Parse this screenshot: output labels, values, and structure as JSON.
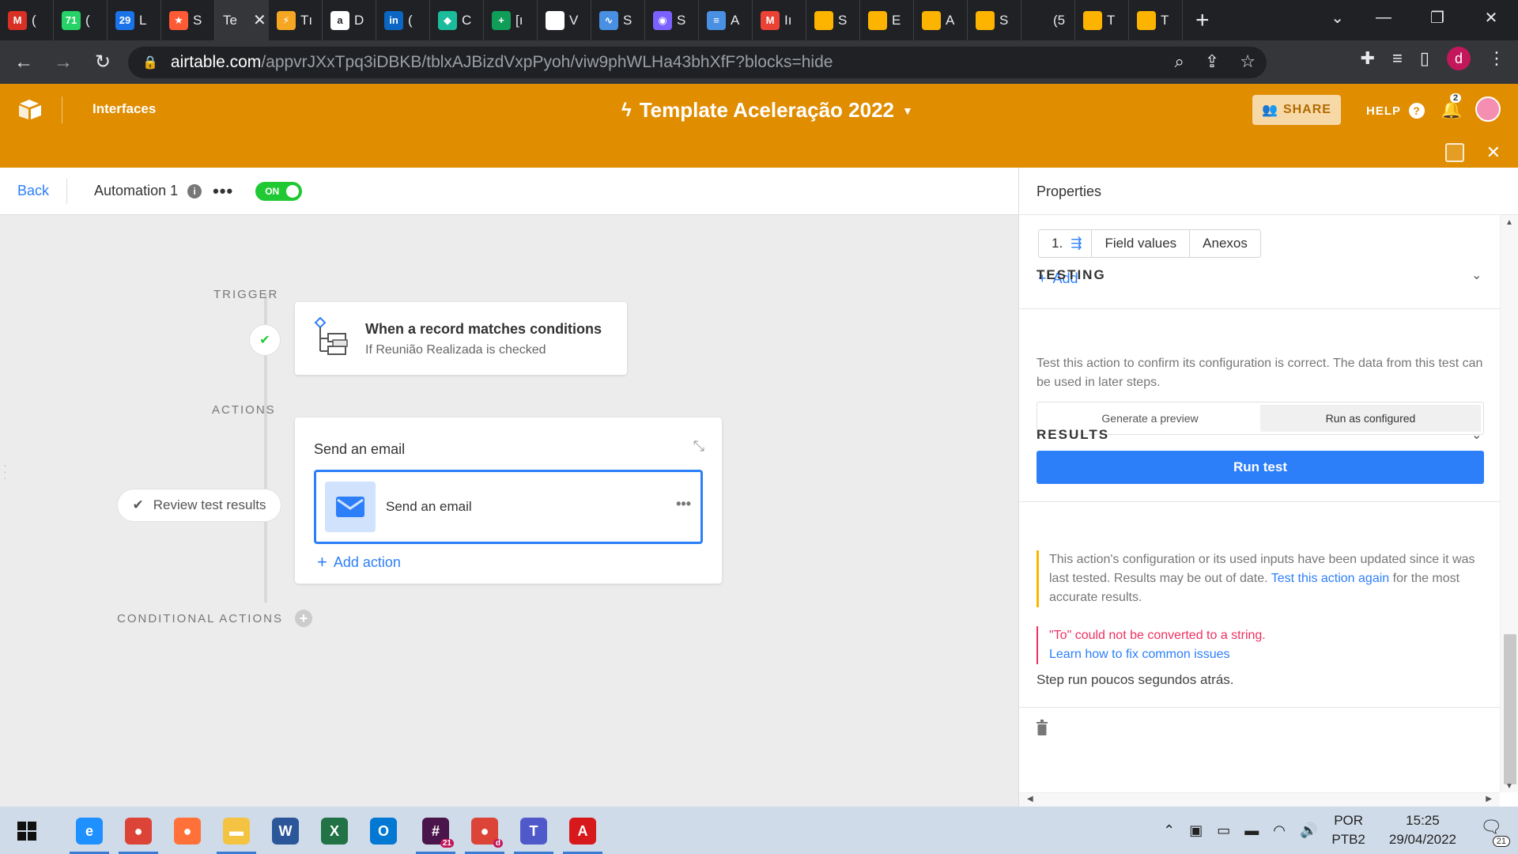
{
  "browser": {
    "tabs": [
      {
        "title": "(",
        "icon": "gmail-like-icon",
        "color": "#d93025",
        "glyph": "M"
      },
      {
        "title": "(",
        "icon": "whatsapp-icon",
        "color": "#25d366",
        "glyph": "71"
      },
      {
        "title": "L",
        "icon": "calendar-icon",
        "color": "#1a73e8",
        "glyph": "29"
      },
      {
        "title": "S",
        "icon": "star-icon",
        "color": "#ff5a36",
        "glyph": "★"
      },
      {
        "title": "Te",
        "icon": "airtable-icon",
        "color": "#35363a",
        "glyph": ""
      },
      {
        "title": "Tı",
        "icon": "bolt-icon",
        "color": "#f5a623",
        "glyph": "⚡"
      },
      {
        "title": "D",
        "icon": "a-icon",
        "color": "#ffffff",
        "glyph": "a"
      },
      {
        "title": "(",
        "icon": "linkedin-icon",
        "color": "#0a66c2",
        "glyph": "in"
      },
      {
        "title": "C",
        "icon": "shield-icon",
        "color": "#1abc9c",
        "glyph": "◆"
      },
      {
        "title": "[ı",
        "icon": "plus-green-icon",
        "color": "#0f9d58",
        "glyph": "+"
      },
      {
        "title": "V",
        "icon": "blank-white-icon",
        "color": "#ffffff",
        "glyph": ""
      },
      {
        "title": "S",
        "icon": "pulse-icon",
        "color": "#4a90e2",
        "glyph": "∿"
      },
      {
        "title": "S",
        "icon": "gauge-icon",
        "color": "#7b61ff",
        "glyph": "◉"
      },
      {
        "title": "A",
        "icon": "flow-icon",
        "color": "#4a90e2",
        "glyph": "≡"
      },
      {
        "title": "Iı",
        "icon": "gmail-icon",
        "color": "#ea4335",
        "glyph": "M"
      },
      {
        "title": "S",
        "icon": "airtable-icon",
        "color": "#fcb400",
        "glyph": ""
      },
      {
        "title": "E",
        "icon": "airtable-icon",
        "color": "#fcb400",
        "glyph": ""
      },
      {
        "title": "A",
        "icon": "airtable-icon",
        "color": "#fcb400",
        "glyph": ""
      },
      {
        "title": "S",
        "icon": "airtable-icon",
        "color": "#fcb400",
        "glyph": ""
      },
      {
        "title": "(5 🔈",
        "icon": "audio-icon",
        "color": "#202124",
        "glyph": ""
      },
      {
        "title": "T",
        "icon": "airtable-icon",
        "color": "#fcb400",
        "glyph": ""
      },
      {
        "title": "T",
        "icon": "airtable-icon",
        "color": "#fcb400",
        "glyph": ""
      }
    ],
    "url_host": "airtable.com",
    "url_path": "/appvrJXxTpq3iDBKB/tblxAJBizdVxpPyoh/viw9phWLHa43bhXfF?blocks=hide",
    "profile_initial": "d"
  },
  "airtable": {
    "interfaces_label": "Interfaces",
    "base_title": "Template Aceleração 2022",
    "share_label": "SHARE",
    "help_label": "HELP",
    "notification_count": "2",
    "brand_color": "#e08d00"
  },
  "automation": {
    "back_label": "Back",
    "name": "Automation 1",
    "toggle_label": "ON",
    "toggle_color": "#20c933"
  },
  "canvas": {
    "trigger_label": "TRIGGER",
    "actions_label": "ACTIONS",
    "conditional_label": "CONDITIONAL ACTIONS",
    "trigger_title": "When a record matches conditions",
    "trigger_subtitle": "If Reunião Realizada is checked",
    "action_header": "Send an email",
    "action_step_label": "Send an email",
    "add_action_label": "Add action",
    "review_label": "Review test results"
  },
  "properties": {
    "title": "Properties",
    "tokens": [
      "1.",
      "Field values",
      "Anexos"
    ],
    "add_label": "Add",
    "testing": {
      "title": "TESTING",
      "description": "Test this action to confirm its configuration is correct. The data from this test can be used in later steps.",
      "options": [
        "Generate a preview",
        "Run as configured"
      ],
      "selected_option": "Run as configured",
      "run_button": "Run test",
      "accent": "#2d7ff9"
    },
    "results": {
      "title": "RESULTS",
      "warning_pre": "This action's configuration or its used inputs have been updated since it was last tested. Results may be out of date.",
      "warning_link": "Test this action again",
      "warning_post": "for the most accurate results.",
      "error_text": "\"To\" could not be converted to a string.",
      "error_link": "Learn how to fix common issues",
      "step_run": "Step run poucos segundos atrás.",
      "warning_color": "#fcb400",
      "error_color": "#ef3061"
    }
  },
  "taskbar": {
    "apps": [
      {
        "name": "internet-explorer-icon",
        "color": "#1e90ff",
        "glyph": "e"
      },
      {
        "name": "chrome-icon",
        "color": "#db4437",
        "glyph": "●"
      },
      {
        "name": "firefox-icon",
        "color": "#ff7139",
        "glyph": "●"
      },
      {
        "name": "file-explorer-icon",
        "color": "#f5c342",
        "glyph": "▬"
      },
      {
        "name": "word-icon",
        "color": "#2b579a",
        "glyph": "W"
      },
      {
        "name": "excel-icon",
        "color": "#217346",
        "glyph": "X"
      },
      {
        "name": "outlook-icon",
        "color": "#0078d4",
        "glyph": "O"
      },
      {
        "name": "slack-icon",
        "color": "#4a154b",
        "glyph": "#"
      },
      {
        "name": "chrome-profile-icon",
        "color": "#db4437",
        "glyph": "●"
      },
      {
        "name": "teams-icon",
        "color": "#5059c9",
        "glyph": "T"
      },
      {
        "name": "acrobat-icon",
        "color": "#d7191c",
        "glyph": "A"
      }
    ],
    "slack_badge": "21",
    "chrome_badge": "d",
    "language": "POR",
    "layout": "PTB2",
    "time": "15:25",
    "date": "29/04/2022",
    "notifications": "21"
  }
}
